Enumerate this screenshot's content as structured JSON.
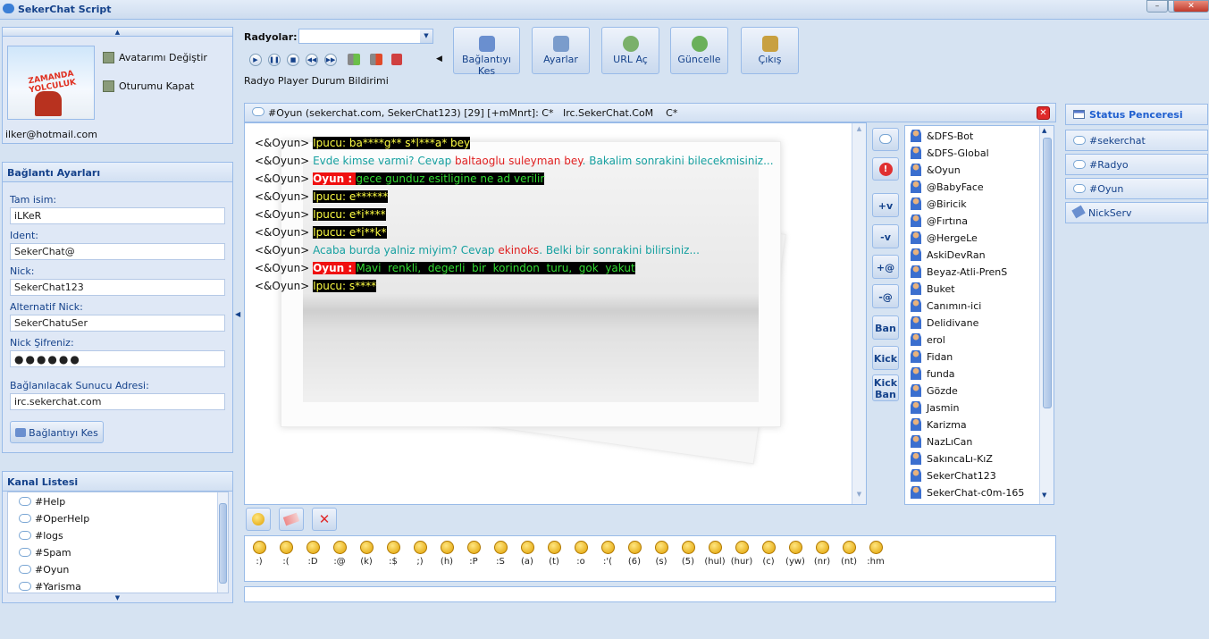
{
  "app": {
    "title": "SekerChat Script"
  },
  "profile": {
    "change_avatar": "Avatarımı Değiştir",
    "logout": "Oturumu Kapat",
    "email": "ilker@hotmail.com",
    "poster_title": "ZAMANDA YOLCULUK"
  },
  "connection": {
    "title": "Bağlantı Ayarları",
    "fullname_label": "Tam isim:",
    "fullname": "iLKeR",
    "ident_label": "Ident:",
    "ident": "SekerChat@",
    "nick_label": "Nick:",
    "nick": "SekerChat123",
    "alt_nick_label": "Alternatif Nick:",
    "alt_nick": "SekerChatuSer",
    "password_label": "Nick Şifreniz:",
    "password": "●●●●●●",
    "server_label": "Bağlanılacak Sunucu Adresi:",
    "server": "irc.sekerchat.com",
    "disconnect": "Bağlantıyı Kes"
  },
  "channels": {
    "title": "Kanal Listesi",
    "items": [
      "#Help",
      "#OperHelp",
      "#logs",
      "#Spam",
      "#Oyun",
      "#Yarisma"
    ]
  },
  "radio": {
    "label": "Radyolar:",
    "status": "Radyo Player Durum Bildirimi"
  },
  "toolbar": {
    "disconnect": "Bağlantıyı Kes",
    "settings": "Ayarlar",
    "open_url": "URL Aç",
    "update": "Güncelle",
    "exit": "Çıkış"
  },
  "chat": {
    "header": "#Oyun (sekerchat.com, SekerChat123) [29] [+mMnrt]: C*   Irc.SekerChat.CoM    C*",
    "prefix": "<&Oyun>",
    "lines": [
      {
        "a": "",
        "b": "Ipucu: ba****g** s*l***a* bey",
        "c": "",
        "d": "",
        "e": ""
      },
      {
        "a": "Evde kimse varmi? Cevap ",
        "b": "baltaoglu suleyman bey",
        "c": ". Bakalim sonrakini bilecekmisiniz...",
        "d": "",
        "e": ""
      },
      {
        "a": "Oyun : ",
        "b": "gece gunduz esitligine ne ad verilir",
        "c": "",
        "d": "",
        "e": ""
      },
      {
        "a": "",
        "b": "Ipucu: e******",
        "c": "",
        "d": "",
        "e": ""
      },
      {
        "a": "",
        "b": "Ipucu: e*i****",
        "c": "",
        "d": "",
        "e": ""
      },
      {
        "a": "",
        "b": "Ipucu: e*i**k*",
        "c": "",
        "d": "",
        "e": ""
      },
      {
        "a": "Acaba burda yalniz miyim? Cevap ",
        "b": "ekinoks",
        "c": ". Belki bir sonrakini bilirsiniz...",
        "d": "",
        "e": ""
      },
      {
        "a": "Oyun : ",
        "b": "Mavi  renkli,  degerli  bir  korindon  turu,  gok  yakut",
        "c": "",
        "d": "",
        "e": ""
      },
      {
        "a": "",
        "b": "Ipucu: s****",
        "c": "",
        "d": "",
        "e": ""
      }
    ]
  },
  "modes": [
    "+v",
    "-v",
    "+@",
    "-@",
    "Ban",
    "Kick",
    "Kick\nBan"
  ],
  "nicklist": [
    "&DFS-Bot",
    "&DFS-Global",
    "&Oyun",
    "@BabyFace",
    "@Biricik",
    "@Fırtına",
    "@HergeLe",
    "AskiDevRan",
    "Beyaz-Atli-PrenS",
    "Buket",
    "Canımın-ici",
    "Delidivane",
    "erol",
    "Fidan",
    "funda",
    "Gözde",
    "Jasmin",
    "Karizma",
    "NazLıCan",
    "SakıncaLı-KıZ",
    "SekerChat123",
    "SekerChat-c0m-165"
  ],
  "smileys": [
    ":)",
    ":(",
    ":D",
    ":@",
    "(k)",
    ":$",
    ";)",
    "(h)",
    ":P",
    ":S",
    "(a)",
    "(t)",
    ":o",
    ":'(",
    "(6)",
    "(s)",
    "(5)",
    "(hul)",
    "(hur)",
    "(c)",
    "(yw)",
    "(nr)",
    "(nt)",
    ":hm"
  ],
  "windows": {
    "status": "Status Penceresi",
    "items": [
      "#sekerchat",
      "#Radyo",
      "#Oyun",
      "NickServ"
    ]
  },
  "colors": {
    "accent": "#15428b",
    "border": "#99bbe8",
    "bg": "#d6e3f2"
  }
}
